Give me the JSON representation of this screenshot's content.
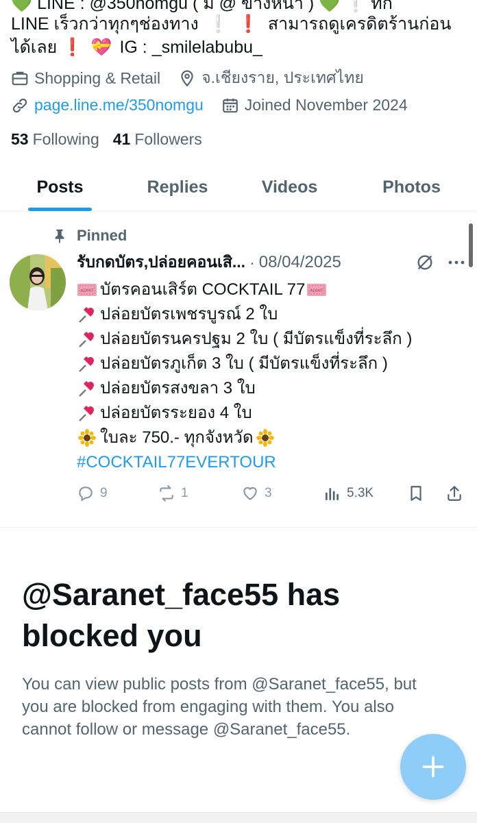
{
  "bio": {
    "line_top": "💚 LINE : @350nomgu ( มี @ ข้างหน้า ) 💚 ❕ ทัก",
    "line1": "LINE เร็วกว่าทุกๆช่องทาง",
    "line1_tail": "สามารถดูเครดิตร้านก่อน",
    "line2_start": "ได้เลย",
    "line2_ig": "IG : _smilelabubu_"
  },
  "profile_meta": {
    "category": "Shopping & Retail",
    "location": "จ.เชียงราย, ประเทศไทย",
    "website": "page.line.me/350nomgu",
    "joined": "Joined November 2024"
  },
  "counts": {
    "following_value": "53",
    "following_label": "Following",
    "followers_value": "41",
    "followers_label": "Followers"
  },
  "tabs": [
    {
      "label": "Posts",
      "active": true
    },
    {
      "label": "Replies",
      "active": false
    },
    {
      "label": "Videos",
      "active": false
    },
    {
      "label": "Photos",
      "active": false
    }
  ],
  "post": {
    "pinned_label": "Pinned",
    "display_name": "รับกดบัตร,ปล่อยคอนเสิ...",
    "separator": "·",
    "date": "08/04/2025",
    "lines": [
      {
        "icon": "ticket",
        "text": "บัตรคอนเสิร์ต COCKTAIL 77",
        "trail": "ticket"
      },
      {
        "icon": "pin",
        "text": "ปล่อยบัตรเพชรบูรณ์ 2 ใบ"
      },
      {
        "icon": "pin",
        "text": "ปล่อยบัตรนครปฐม 2 ใบ  ( มีบัตรแข็งที่ระลึก )"
      },
      {
        "icon": "pin",
        "text": "ปล่อยบัตรภูเก็ต 3 ใบ ( มีบัตรแข็งที่ระลึก )"
      },
      {
        "icon": "pin",
        "text": "ปล่อยบัตรสงขลา 3 ใบ"
      },
      {
        "icon": "pin",
        "text": "ปล่อยบัตรระยอง 4 ใบ"
      },
      {
        "icon": "sunflower",
        "text": " ใบละ 750.- ทุกจังหวัด",
        "trail": "sunflower"
      }
    ],
    "hashtag": "#COCKTAIL77EVERTOUR",
    "actions": {
      "replies": "9",
      "reposts": "1",
      "likes": "3",
      "views": "5.3K"
    }
  },
  "blocked": {
    "title": "@Saranet_face55 has blocked you",
    "message": "You can view public posts from @Saranet_face55, but you are blocked from engaging with them. You also cannot follow or message @Saranet_face55."
  },
  "colors": {
    "accent": "#1d9bf0",
    "text": "#0f1419",
    "secondary": "#536471",
    "fab": "#8ecdf8"
  }
}
